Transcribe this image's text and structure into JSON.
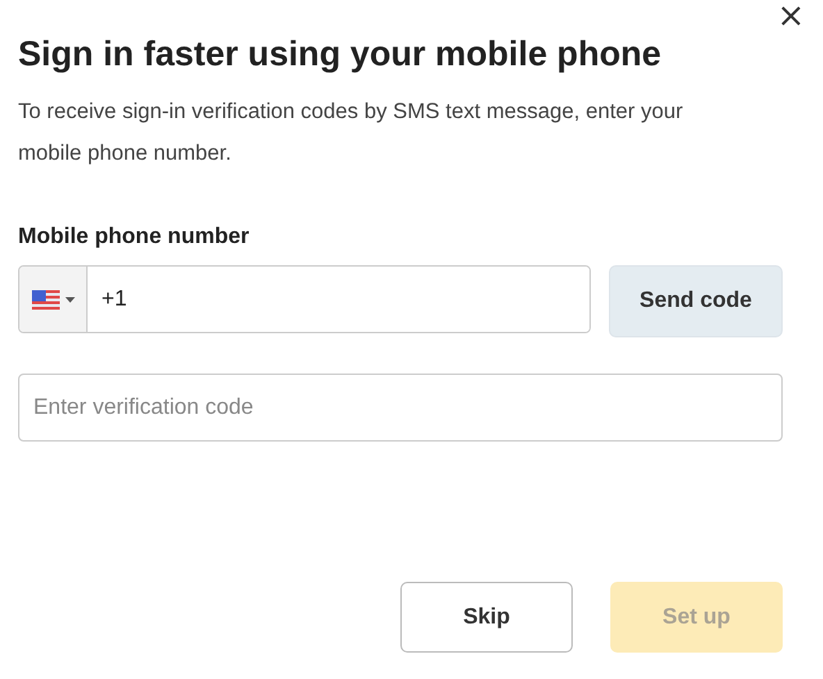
{
  "close_button": {
    "label": "×"
  },
  "title": "Sign in faster using your mobile phone",
  "description": "To receive sign-in verification codes by SMS text message, enter your mobile phone number.",
  "phone": {
    "label": "Mobile phone number",
    "value": "+1",
    "send_button": {
      "label": "Send code",
      "disabled": false
    }
  },
  "verification": {
    "placeholder": "Enter verification code"
  },
  "buttons": [
    {
      "kind": "secondary",
      "label": "Skip",
      "disabled": false
    },
    {
      "kind": "primary",
      "label": "Set up",
      "disabled": true
    }
  ]
}
